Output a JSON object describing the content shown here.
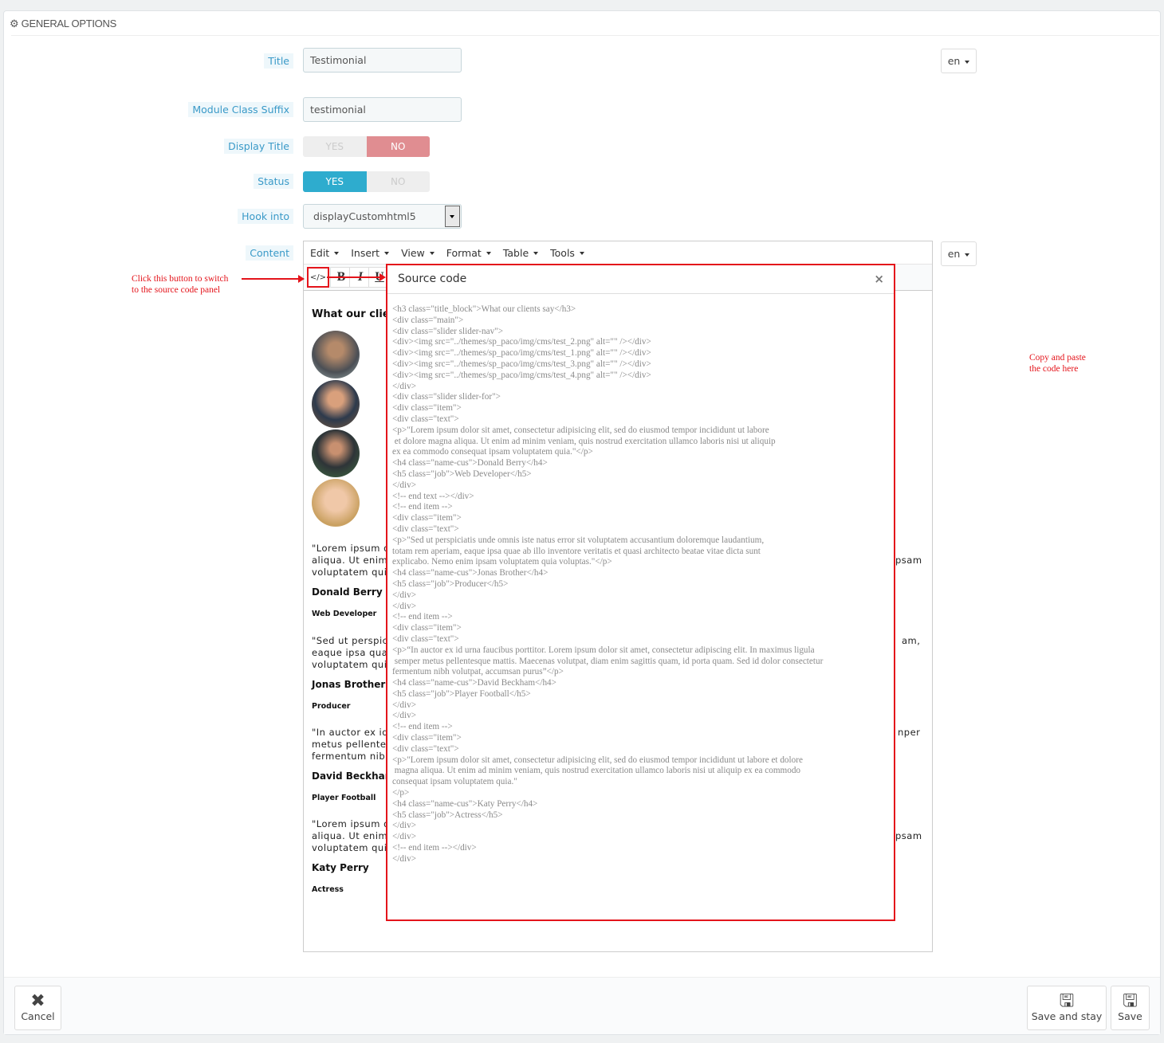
{
  "panel": {
    "title": "GENERAL OPTIONS",
    "icon": "cogs-icon"
  },
  "form": {
    "title": {
      "label": "Title",
      "value": "Testimonial",
      "lang": "en"
    },
    "suffix": {
      "label": "Module Class Suffix",
      "value": "testimonial"
    },
    "display_title": {
      "label": "Display Title",
      "yes": "YES",
      "no": "NO",
      "selected": "NO"
    },
    "status": {
      "label": "Status",
      "yes": "YES",
      "no": "NO",
      "selected": "YES"
    },
    "hook": {
      "label": "Hook into",
      "value": "displayCustomhtml5"
    },
    "content": {
      "label": "Content",
      "lang": "en"
    }
  },
  "editor": {
    "menu": [
      "Edit",
      "Insert",
      "View",
      "Format",
      "Table",
      "Tools"
    ],
    "toolbar": {
      "source": "</>",
      "bold": "B",
      "italic": "I",
      "underline": "U"
    },
    "content": {
      "heading": "What our clie",
      "p1": [
        "\"Lorem ipsum d",
        "aliqua. Ut enim",
        "voluptatem quia"
      ],
      "p1_right": "psam",
      "n1": "Donald Berry",
      "j1": "Web Developer",
      "p2": [
        "\"Sed ut perspic",
        "eaque ipsa quae",
        "voluptatem quia"
      ],
      "p2_right": "am,",
      "n2": "Jonas Brother",
      "j2": "Producer",
      "p3": [
        "\"In auctor ex id",
        "metus pellentes",
        "fermentum nibh"
      ],
      "p3_right": "nper",
      "n3": "David Beckham",
      "j3": "Player Football",
      "p4": [
        "\"Lorem ipsum d",
        "aliqua. Ut enim",
        "voluptatem quia"
      ],
      "p4_right": "psam",
      "n4": "Katy Perry",
      "j4": "Actress"
    }
  },
  "modal": {
    "title": "Source code",
    "close": "×",
    "code": [
      "<h3 class=\"title_block\">What our clients say</h3>",
      "<div class=\"main\">",
      "<div class=\"slider slider-nav\">",
      "<div><img src=\"../themes/sp_paco/img/cms/test_2.png\" alt=\"\" /></div>",
      "<div><img src=\"../themes/sp_paco/img/cms/test_1.png\" alt=\"\" /></div>",
      "<div><img src=\"../themes/sp_paco/img/cms/test_3.png\" alt=\"\" /></div>",
      "<div><img src=\"../themes/sp_paco/img/cms/test_4.png\" alt=\"\" /></div>",
      "</div>",
      "<div class=\"slider slider-for\">",
      "<div class=\"item\">",
      "<div class=\"text\">",
      "<p>\"Lorem ipsum dolor sit amet, consectetur adipisicing elit, sed do eiusmod tempor incididunt ut labore",
      " et dolore magna aliqua. Ut enim ad minim veniam, quis nostrud exercitation ullamco laboris nisi ut aliquip",
      "ex ea commodo consequat ipsam voluptatem quia.\"</p>",
      "<h4 class=\"name-cus\">Donald Berry</h4>",
      "<h5 class=\"job\">Web Developer</h5>",
      "</div>",
      "<!-- end text --></div>",
      "<!-- end item -->",
      "<div class=\"item\">",
      "<div class=\"text\">",
      "<p>\"Sed ut perspiciatis unde omnis iste natus error sit voluptatem accusantium doloremque laudantium,",
      "totam rem aperiam, eaque ipsa quae ab illo inventore veritatis et quasi architecto beatae vitae dicta sunt",
      "explicabo. Nemo enim ipsam voluptatem quia voluptas.\"</p>",
      "<h4 class=\"name-cus\">Jonas Brother</h4>",
      "<h5 class=\"job\">Producer</h5>",
      "</div>",
      "</div>",
      "<!-- end item -->",
      "<div class=\"item\">",
      "<div class=\"text\">",
      "<p>“In auctor ex id urna faucibus porttitor. Lorem ipsum dolor sit amet, consectetur adipiscing elit. In maximus ligula",
      " semper metus pellentesque mattis. Maecenas volutpat, diam enim sagittis quam, id porta quam. Sed id dolor consectetur",
      "fermentum nibh volutpat, accumsan purus”</p>",
      "<h4 class=\"name-cus\">David Beckham</h4>",
      "<h5 class=\"job\">Player Football</h5>",
      "</div>",
      "</div>",
      "<!-- end item -->",
      "<div class=\"item\">",
      "<div class=\"text\">",
      "<p>\"Lorem ipsum dolor sit amet, consectetur adipisicing elit, sed do eiusmod tempor incididunt ut labore et dolore",
      " magna aliqua. Ut enim ad minim veniam, quis nostrud exercitation ullamco laboris nisi ut aliquip ex ea commodo",
      "consequat ipsam voluptatem quia.\"",
      "</p>",
      "<h4 class=\"name-cus\">Katy Perry</h4>",
      "<h5 class=\"job\">Actress</h5>",
      "</div>",
      "</div>",
      "<!-- end item --></div>",
      "</div>"
    ]
  },
  "annotations": {
    "source_hint": [
      "Click this button to switch",
      "to the source code panel"
    ],
    "paste_hint": [
      "Copy and paste",
      "the code here"
    ],
    "color": "#e4141b"
  },
  "footer": {
    "cancel": "Cancel",
    "save_stay": "Save and stay",
    "save": "Save"
  }
}
